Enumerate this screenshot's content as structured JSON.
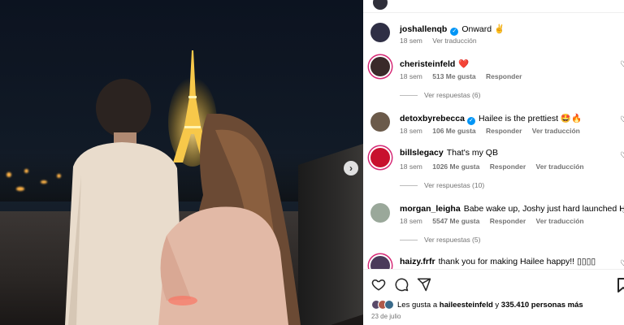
{
  "post": {
    "next_icon": "chevron-right-icon"
  },
  "caption": {
    "user": "joshallenqb",
    "text": "Onward ✌️",
    "time": "18 sem",
    "translate": "Ver traducción"
  },
  "comments": [
    {
      "user": "cheristeinfeld",
      "text": "❤️",
      "time": "18 sem",
      "likes": "513 Me gusta",
      "reply": "Responder",
      "translate": "",
      "verified": false,
      "replies": "Ver respuestas (6)",
      "avatar_color": "#3a2a2a"
    },
    {
      "user": "detoxbyrebecca",
      "text": "Hailee is the prettiest 🤩🔥",
      "time": "18 sem",
      "likes": "106 Me gusta",
      "reply": "Responder",
      "translate": "Ver traducción",
      "verified": true,
      "replies": "",
      "avatar_color": "#6b5a4a"
    },
    {
      "user": "billslegacy",
      "text": "That's my QB",
      "time": "18 sem",
      "likes": "1026 Me gusta",
      "reply": "Responder",
      "translate": "Ver traducción",
      "verified": false,
      "replies": "Ver respuestas (10)",
      "avatar_color": "#c8102e"
    },
    {
      "user": "morgan_leigha",
      "text": "Babe wake up, Joshy just hard launched Hailee",
      "time": "18 sem",
      "likes": "5547 Me gusta",
      "reply": "Responder",
      "translate": "Ver traducción",
      "verified": false,
      "replies": "Ver respuestas (5)",
      "avatar_color": "#9aa89a"
    },
    {
      "user": "haizy.frfr",
      "text": "thank you for making Hailee happy!! ▯▯▯▯",
      "time": "",
      "likes": "",
      "reply": "",
      "translate": "",
      "verified": false,
      "replies": "",
      "avatar_color": "#4a3b5a"
    }
  ],
  "footer": {
    "likes_prefix": "Les gusta a",
    "likes_user": "haileesteinfeld",
    "likes_middle": "y",
    "likes_count": "335.410 personas más",
    "date": "23 de julio"
  },
  "colors": {
    "accent": "#0095f6",
    "ring": "#d62976",
    "muted": "#737373"
  }
}
